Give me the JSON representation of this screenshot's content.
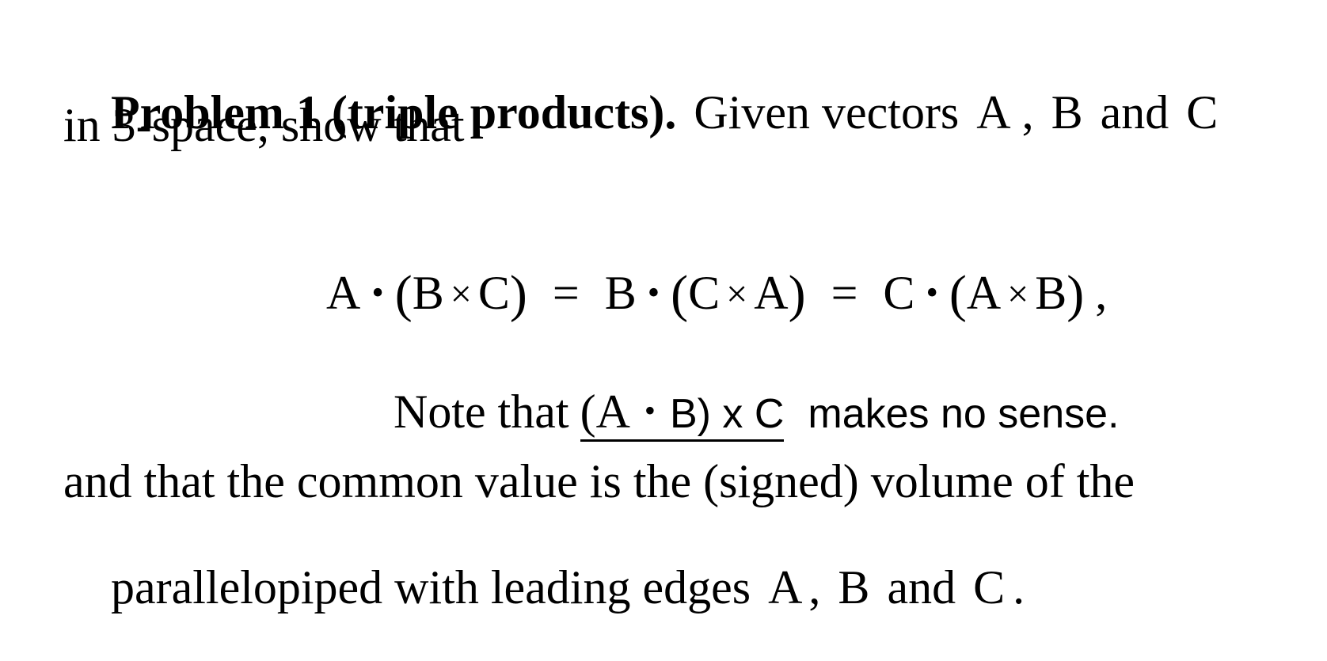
{
  "document": {
    "problem_heading": "Problem 1 (triple products).",
    "intro": {
      "given_text": "Given vectors",
      "vector_a": "A",
      "comma_1": ",",
      "vector_b": "B",
      "and_1": "and",
      "vector_c": "C",
      "line_2": "in 3-space, show that"
    },
    "equation": {
      "term_1": {
        "outer": "A",
        "dot": "•",
        "open": "(",
        "left": "B",
        "cross": "×",
        "right": "C",
        "close": ")"
      },
      "equals_1": "=",
      "term_2": {
        "outer": "B",
        "dot": "•",
        "open": "(",
        "left": "C",
        "cross": "×",
        "right": "A",
        "close": ")"
      },
      "equals_2": "=",
      "term_3": {
        "outer": "C",
        "dot": "•",
        "open": "(",
        "left": "A",
        "cross": "×",
        "right": "B",
        "close": ")"
      },
      "trailing_comma": ","
    },
    "note": {
      "prefix": "Note that",
      "expr_open_a": "(A",
      "expr_dot": "•",
      "expr_rest": "B) x C",
      "suffix": "makes no sense."
    },
    "conclusion": {
      "line_1": "and that the common value is the (signed) volume of the",
      "line_2_text": "parallelopiped with leading edges",
      "vector_a": "A",
      "comma": ",",
      "vector_b": "B",
      "and": "and",
      "vector_c": "C",
      "period": "."
    }
  }
}
